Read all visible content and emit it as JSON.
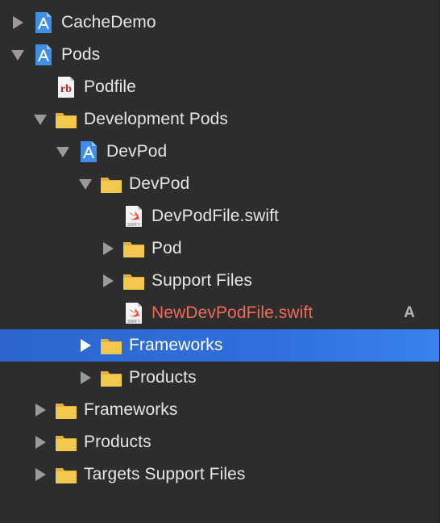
{
  "project_navigator": {
    "items": [
      {
        "label": "CacheDemo",
        "icon": "xcode-project-icon",
        "expanded": false,
        "has_disclosure": true
      },
      {
        "label": "Pods",
        "icon": "xcode-project-icon",
        "expanded": true,
        "has_disclosure": true
      },
      {
        "label": "Podfile",
        "icon": "ruby-file-icon",
        "expanded": false,
        "has_disclosure": false
      },
      {
        "label": "Development Pods",
        "icon": "folder-icon",
        "expanded": true,
        "has_disclosure": true
      },
      {
        "label": "DevPod",
        "icon": "xcode-project-icon",
        "expanded": true,
        "has_disclosure": true
      },
      {
        "label": "DevPod",
        "icon": "folder-icon",
        "expanded": true,
        "has_disclosure": true
      },
      {
        "label": "DevPodFile.swift",
        "icon": "swift-file-icon",
        "expanded": false,
        "has_disclosure": false
      },
      {
        "label": "Pod",
        "icon": "folder-icon",
        "expanded": false,
        "has_disclosure": true
      },
      {
        "label": "Support Files",
        "icon": "folder-icon",
        "expanded": false,
        "has_disclosure": true
      },
      {
        "label": "NewDevPodFile.swift",
        "icon": "swift-file-icon",
        "expanded": false,
        "has_disclosure": false,
        "status_badge": "A",
        "status_color": "#f06a5a"
      },
      {
        "label": "Frameworks",
        "icon": "folder-icon",
        "expanded": false,
        "has_disclosure": true,
        "selected": true
      },
      {
        "label": "Products",
        "icon": "folder-icon",
        "expanded": false,
        "has_disclosure": true
      },
      {
        "label": "Frameworks",
        "icon": "folder-icon",
        "expanded": false,
        "has_disclosure": true
      },
      {
        "label": "Products",
        "icon": "folder-icon",
        "expanded": false,
        "has_disclosure": true
      },
      {
        "label": "Targets Support Files",
        "icon": "folder-icon",
        "expanded": false,
        "has_disclosure": true
      }
    ]
  },
  "colors": {
    "background": "#2d2d2d",
    "selection": "#2f6fdc",
    "text": "#e6e6e6",
    "added_file_text": "#f06a5a",
    "folder": "#f2c94c",
    "project_icon": "#3f8ee8"
  }
}
